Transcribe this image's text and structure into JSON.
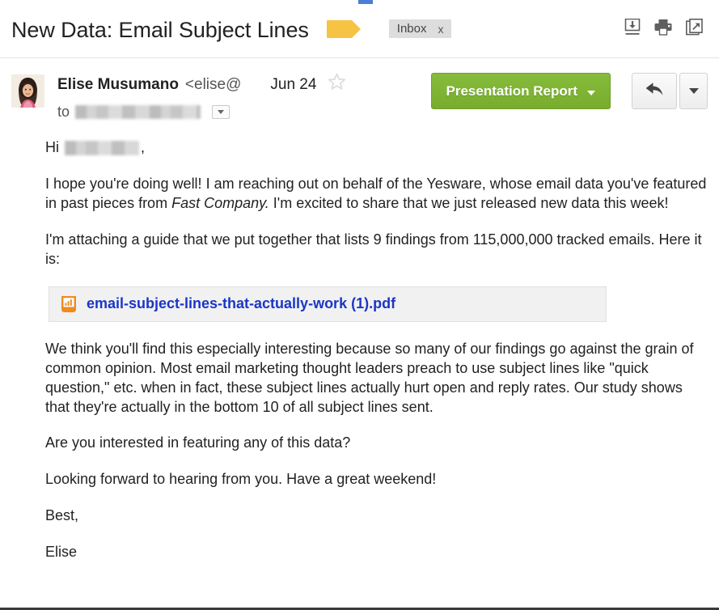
{
  "window": {
    "accent_green": "#7cb342",
    "label_color": "#f6c344",
    "link_color": "#1a36c6"
  },
  "subject_bar": {
    "title": "New Data: Email Subject Lines",
    "label_tag_name": "label-tag-yellow",
    "inbox_chip": "Inbox",
    "inbox_chip_remove": "x",
    "icons": [
      {
        "name": "download-icon",
        "label": "Download"
      },
      {
        "name": "print-icon",
        "label": "Print"
      },
      {
        "name": "open-in-new-window-icon",
        "label": "Open in new window"
      }
    ]
  },
  "message_header": {
    "avatar_name": "sender-avatar-photo",
    "sender_name": "Elise Musumano",
    "sender_email": "<elise@",
    "date": "Jun 24",
    "star_state": "unstarred",
    "to_label": "to",
    "to_value_redacted": "",
    "details_toggle": "show details"
  },
  "actions": {
    "primary_button": "Presentation Report",
    "primary_button_caret": "▾",
    "reply_button": "Reply",
    "more_button": "More options"
  },
  "body": {
    "greeting_prefix": "Hi",
    "greeting_redacted": "",
    "greeting_comma": ",",
    "para1_part1": "I hope you're doing well! I am reaching out on behalf of the Yesware, whose email data you've featured in past pieces from ",
    "para1_italic": "Fast Company.",
    "para1_part2": " I'm excited to share that we just released new data this week!",
    "para2": "I'm attaching a guide that we put together that lists 9 findings from 115,000,000 tracked emails. Here it is:",
    "attachment": {
      "icon_name": "pdf-file-icon",
      "filename": "email-subject-lines-that-actually-work (1).pdf"
    },
    "para3": "We think you'll find this especially interesting because so many of our findings go against the grain of common opinion. Most email marketing thought leaders preach to use subject lines like \"quick question,\" etc. when in fact, these subject lines actually hurt open and reply rates. Our study shows that they're actually in the bottom 10 of all subject lines sent.",
    "para4": "Are you interested in featuring any of this data?",
    "para5": "Looking forward to hearing from you. Have a great weekend!",
    "signoff": "Best,",
    "signature": "Elise"
  }
}
